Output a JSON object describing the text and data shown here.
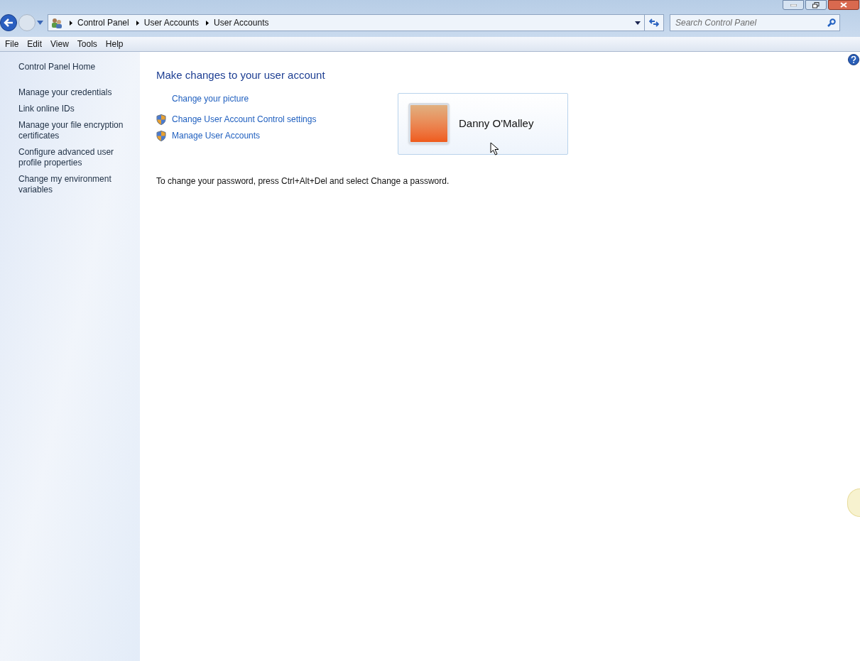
{
  "breadcrumb": [
    "Control Panel",
    "User Accounts",
    "User Accounts"
  ],
  "search": {
    "placeholder": "Search Control Panel"
  },
  "menu": [
    "File",
    "Edit",
    "View",
    "Tools",
    "Help"
  ],
  "sidebar": {
    "home": "Control Panel Home",
    "items": [
      "Manage your credentials",
      "Link online IDs",
      "Manage your file encryption certificates",
      "Configure advanced user profile properties",
      "Change my environment variables"
    ]
  },
  "main": {
    "title": "Make changes to your user account",
    "tasks": [
      {
        "label": "Change your picture",
        "shield": false
      },
      {
        "label": "Change User Account Control settings",
        "shield": true
      },
      {
        "label": "Manage User Accounts",
        "shield": true
      }
    ],
    "account": {
      "name": "Danny O'Malley"
    },
    "note": "To change your password, press Ctrl+Alt+Del and select Change a password."
  }
}
